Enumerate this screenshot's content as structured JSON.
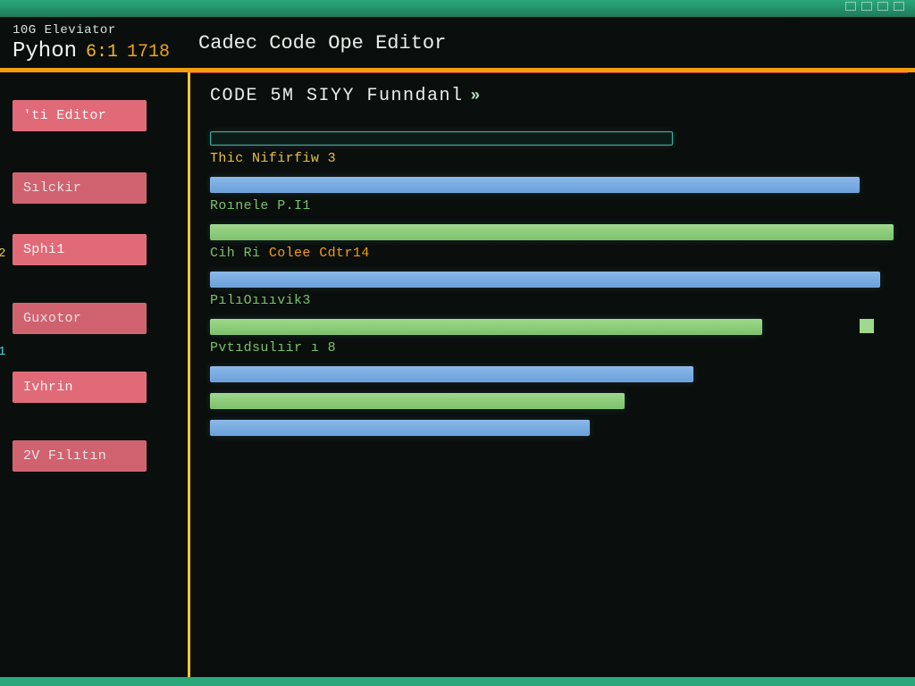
{
  "titlebar": {
    "app_hint": "10G Eleviator"
  },
  "tabs": {
    "left_small": "10G Eleviator",
    "main_name": "Pyhon",
    "main_ver_a": "6:1",
    "main_ver_b": "1718",
    "right_title": "Cadec Code Ope Editor"
  },
  "sidebar": {
    "items": [
      {
        "label": "'ti Editor"
      },
      {
        "label": "Sılckir"
      },
      {
        "label": "Sphi1"
      },
      {
        "label": "Guxotor"
      },
      {
        "label": "Ivhrin"
      },
      {
        "label": "2V Fılıtın"
      }
    ],
    "gutter": [
      "2",
      "1"
    ]
  },
  "main": {
    "heading": "CODE 5M SIYY Funndanl",
    "heading_marker": "»",
    "rows": [
      {
        "label": "Thic Nifirfiw 3",
        "label_color": "yellow",
        "bar_color": "teal",
        "width_pct": 67,
        "boxed": true
      },
      {
        "label": "Roınele P.I1",
        "label_color": "green",
        "bar_color": "blue",
        "width_pct": 94
      },
      {
        "label": "Cih Ri Colee Cdtr14",
        "label_color": "mix",
        "bar_color": "green",
        "width_pct": 99
      },
      {
        "label": "PılıOıııvik3",
        "label_color": "green",
        "bar_color": "blue",
        "width_pct": 97
      },
      {
        "label": "Pvtıdsulıir ı 8",
        "label_color": "green",
        "bar_color": "green",
        "width_pct": 80,
        "pip": true
      },
      {
        "label": "",
        "label_color": "green",
        "bar_color": "blue",
        "width_pct": 70
      },
      {
        "label": "",
        "label_color": "green",
        "bar_color": "green",
        "width_pct": 60
      },
      {
        "label": "",
        "label_color": "green",
        "bar_color": "blue",
        "width_pct": 55
      }
    ]
  },
  "colors": {
    "accent_teal": "#2aa87b",
    "accent_yellow": "#f5c531",
    "accent_pink": "#e16a78",
    "accent_orange": "#f59e0b"
  }
}
